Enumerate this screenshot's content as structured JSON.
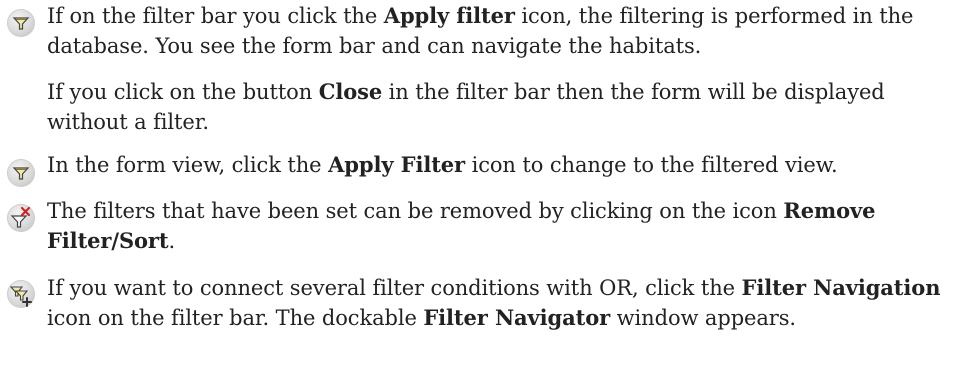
{
  "paragraphs": [
    {
      "id": "apply-filter-bar",
      "icon": "apply-filter-icon",
      "segments": [
        {
          "text": "If on the filter bar you click the ",
          "bold": false
        },
        {
          "text": "Apply filter",
          "bold": true
        },
        {
          "text": " icon, the filtering is performed in the database. You see the form bar and can navigate the habitats.",
          "bold": false
        }
      ]
    },
    {
      "id": "close-button",
      "icon": null,
      "segments": [
        {
          "text": "If you click on the button ",
          "bold": false
        },
        {
          "text": "Close",
          "bold": true
        },
        {
          "text": " in the filter bar then the form will be displayed without a filter.",
          "bold": false
        }
      ]
    },
    {
      "id": "apply-filter-form",
      "icon": "apply-filter-icon",
      "segments": [
        {
          "text": "In the form view, click the ",
          "bold": false
        },
        {
          "text": "Apply Filter",
          "bold": true
        },
        {
          "text": " icon to change to the filtered view.",
          "bold": false
        }
      ]
    },
    {
      "id": "remove-filter",
      "icon": "remove-filter-sort-icon",
      "segments": [
        {
          "text": "The filters that have been set can be removed by clicking on the icon ",
          "bold": false
        },
        {
          "text": "Remove Filter/Sort",
          "bold": true
        },
        {
          "text": ".",
          "bold": false
        }
      ]
    },
    {
      "id": "filter-navigation",
      "icon": "filter-navigation-icon",
      "segments": [
        {
          "text": "If you want to connect several filter conditions with OR, click the ",
          "bold": false
        },
        {
          "text": "Filter Navigation",
          "bold": true
        },
        {
          "text": " icon on the filter bar. The dockable ",
          "bold": false
        },
        {
          "text": "Filter Navigator",
          "bold": true
        },
        {
          "text": " window appears.",
          "bold": false
        }
      ]
    }
  ]
}
